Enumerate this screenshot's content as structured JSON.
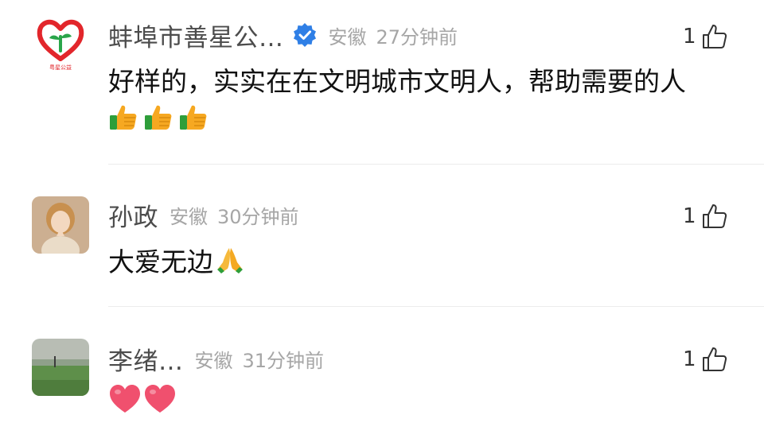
{
  "comments": [
    {
      "username": "蚌埠市善星公…",
      "verified": true,
      "location": "安徽",
      "time": "27分钟前",
      "like_count": "1",
      "text": "好样的，实实在在文明城市文明人，帮助需要的人",
      "emoji": [
        "thumbs-up",
        "thumbs-up",
        "thumbs-up"
      ],
      "avatar_caption": "粤星公益"
    },
    {
      "username": "孙政",
      "verified": false,
      "location": "安徽",
      "time": "30分钟前",
      "like_count": "1",
      "text": "大爱无边",
      "emoji": [
        "folded-hands"
      ]
    },
    {
      "username": "李绪…",
      "verified": false,
      "location": "安徽",
      "time": "31分钟前",
      "like_count": "1",
      "text": "",
      "emoji": [
        "red-heart",
        "red-heart"
      ]
    }
  ],
  "colors": {
    "username": "#4c4c4c",
    "meta": "#a6a6a6",
    "verified_badge": "#2f7fe6",
    "divider": "#ececec",
    "logo_red": "#e2262b",
    "logo_green": "#2aa54a"
  }
}
